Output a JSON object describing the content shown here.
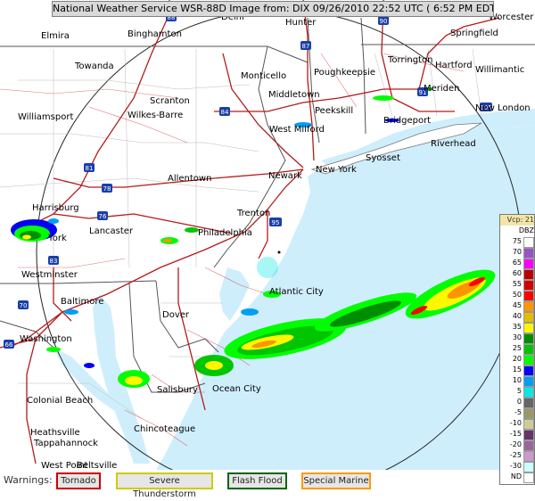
{
  "header": {
    "title": "National Weather Service WSR-88D Image from: DIX 09/26/2010 22:52 UTC ( 6:52 PM EDT)"
  },
  "legend": {
    "header": "Vcp: 21",
    "unit": "DBZ",
    "entries": [
      {
        "label": "75",
        "color": "#ffffff"
      },
      {
        "label": "70",
        "color": "#9854c6"
      },
      {
        "label": "65",
        "color": "#f800fd"
      },
      {
        "label": "60",
        "color": "#bc0000"
      },
      {
        "label": "55",
        "color": "#d40000"
      },
      {
        "label": "50",
        "color": "#fd0000"
      },
      {
        "label": "45",
        "color": "#fd9500"
      },
      {
        "label": "40",
        "color": "#e5bc00"
      },
      {
        "label": "35",
        "color": "#fdf802"
      },
      {
        "label": "30",
        "color": "#008e00"
      },
      {
        "label": "25",
        "color": "#01c501"
      },
      {
        "label": "20",
        "color": "#02fd02"
      },
      {
        "label": "15",
        "color": "#0300f4"
      },
      {
        "label": "10",
        "color": "#019ff4"
      },
      {
        "label": "5",
        "color": "#04e9e7"
      },
      {
        "label": "0",
        "color": "#666666"
      },
      {
        "label": "-5",
        "color": "#999966"
      },
      {
        "label": "-10",
        "color": "#cccc99"
      },
      {
        "label": "-15",
        "color": "#663366"
      },
      {
        "label": "-20",
        "color": "#996699"
      },
      {
        "label": "-25",
        "color": "#cc99cc"
      },
      {
        "label": "-30",
        "color": "#ccffff"
      },
      {
        "label": "ND",
        "color": "#ffffff"
      }
    ]
  },
  "warnings": {
    "label": "Warnings:",
    "items": [
      {
        "label": "Tornado",
        "color": "#cc0000"
      },
      {
        "label": "Severe Thunderstorm",
        "color": "#cccc00"
      },
      {
        "label": "Flash Flood",
        "color": "#006600"
      },
      {
        "label": "Special Marine",
        "color": "#ff9900"
      }
    ]
  },
  "cities": {
    "elmira": "Elmira",
    "binghamton": "Binghamton",
    "delhi": "Delhi",
    "hunter": "Hunter",
    "worcester": "Worcester",
    "springfield": "Springfield",
    "towanda": "Towanda",
    "monticello": "Monticello",
    "poughkeepsie": "Poughkeepsie",
    "torrington": "Torrington",
    "hartford": "Hartford",
    "willimantic": "Willimantic",
    "meriden": "Meriden",
    "middletown": "Middletown",
    "peekskill": "Peekskill",
    "new_london": "New London",
    "williamsport": "Williamsport",
    "wilkes_barre": "Wilkes-Barre",
    "scranton": "Scranton",
    "bridgeport": "Bridgeport",
    "west_milford": "West Milford",
    "riverhead": "Riverhead",
    "syosset": "Syosset",
    "new_york": "New York",
    "newark": "Newark",
    "allentown": "Allentown",
    "trenton": "Trenton",
    "harrisburg": "Harrisburg",
    "york": "York",
    "lancaster": "Lancaster",
    "philadelphia": "Philadelphia",
    "westminster": "Westminster",
    "atlantic_city": "Atlantic City",
    "baltimore": "Baltimore",
    "dover": "Dover",
    "washington": "Washington",
    "salisbury": "Salisbury",
    "ocean_city": "Ocean City",
    "colonial_beach": "Colonial Beach",
    "chincoteague": "Chincoteague",
    "heathsville": "Heathsville",
    "tappahannock": "Tappahannock",
    "west_point": "West Point",
    "beltsville": "Beltsville"
  },
  "highways": {
    "i88": "88",
    "i87": "87",
    "i90": "90",
    "i84": "84",
    "i91": "91",
    "i81": "81",
    "i78": "78",
    "i76": "76",
    "i83": "83",
    "i95": "95",
    "i70": "70",
    "i66": "66",
    "i195": "195"
  }
}
